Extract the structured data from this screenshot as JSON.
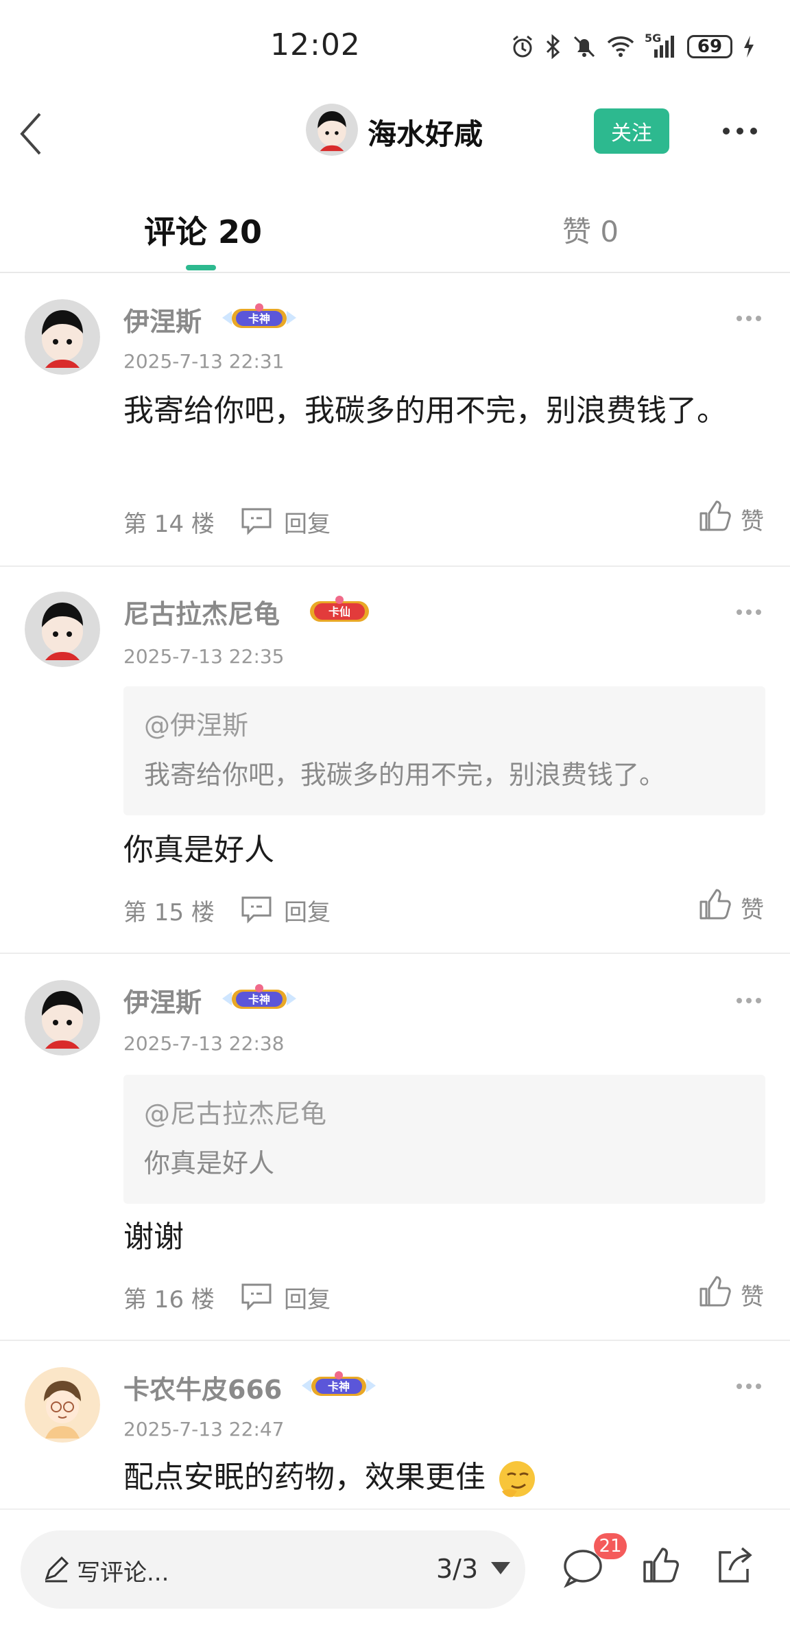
{
  "status_bar": {
    "time": "12:02",
    "network": "5G",
    "battery": "69"
  },
  "header": {
    "username": "海水好咸",
    "follow_label": "关注"
  },
  "tabs": {
    "comments": "评论 20",
    "likes": "赞 0"
  },
  "comments": [
    {
      "user": "伊涅斯",
      "badge": "卡神",
      "time": "2025-7-13 22:31",
      "text": "我寄给你吧，我碳多的用不完，别浪费钱了。",
      "floor": "第 14 楼",
      "reply_label": "回复",
      "like_label": "赞"
    },
    {
      "user": "尼古拉杰尼龟",
      "badge": "卡仙",
      "time": "2025-7-13 22:35",
      "quote": {
        "user": "@伊涅斯",
        "text": "我寄给你吧，我碳多的用不完，别浪费钱了。"
      },
      "text": "你真是好人",
      "floor": "第 15 楼",
      "reply_label": "回复",
      "like_label": "赞"
    },
    {
      "user": "伊涅斯",
      "badge": "卡神",
      "time": "2025-7-13 22:38",
      "quote": {
        "user": "@尼古拉杰尼龟",
        "text": "你真是好人"
      },
      "text": "谢谢",
      "floor": "第 16 楼",
      "reply_label": "回复",
      "like_label": "赞"
    },
    {
      "user": "卡农牛皮666",
      "badge": "卡神",
      "time": "2025-7-13 22:47",
      "text": "配点安眠的药物，效果更佳"
    }
  ],
  "bottom_bar": {
    "placeholder": "写评论...",
    "page_indicator": "3/3",
    "comment_count": "21"
  },
  "colors": {
    "accent": "#2DB98F",
    "badge_red": "#f45b5b",
    "muted": "#8a8a8a"
  }
}
